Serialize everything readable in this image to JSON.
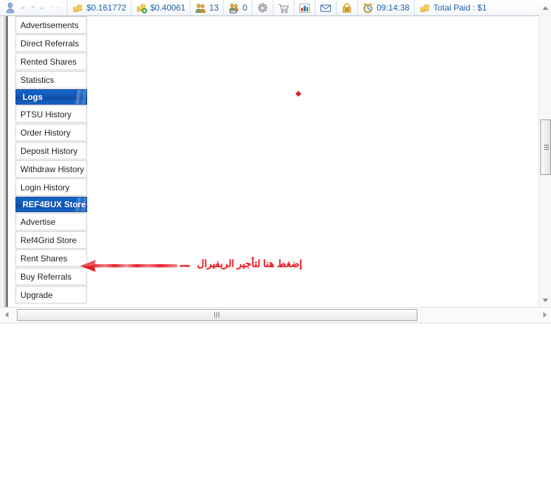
{
  "toolbar": {
    "items": [
      {
        "icon": "user-icon",
        "label": "",
        "redacted": true
      },
      {
        "icon": "coins-icon",
        "label": "$0.161772",
        "redacted": false
      },
      {
        "icon": "coins-add-icon",
        "label": "$0.40061",
        "redacted": false
      },
      {
        "icon": "referrals-icon",
        "label": "13",
        "redacted": false
      },
      {
        "icon": "rented-referrals-icon",
        "label": "0",
        "redacted": false
      },
      {
        "icon": "gear-icon",
        "label": "",
        "redacted": false
      },
      {
        "icon": "shopping-cart-icon",
        "label": "",
        "redacted": false
      },
      {
        "icon": "bar-chart-icon",
        "label": "",
        "redacted": false
      },
      {
        "icon": "envelope-icon",
        "label": "",
        "redacted": false
      },
      {
        "icon": "lock-icon",
        "label": "",
        "redacted": false
      },
      {
        "icon": "alarm-clock-icon",
        "label": "09:14:38",
        "redacted": false
      },
      {
        "icon": "coins-icon",
        "label": "Total Paid : $1",
        "redacted": false
      }
    ]
  },
  "sidebar": {
    "items": [
      {
        "label": "Advertisements",
        "type": "item"
      },
      {
        "label": "Direct Referrals",
        "type": "item"
      },
      {
        "label": "Rented Shares",
        "type": "item"
      },
      {
        "label": "Statistics",
        "type": "item"
      },
      {
        "label": "Logs",
        "type": "header"
      },
      {
        "label": "PTSU History",
        "type": "item"
      },
      {
        "label": "Order History",
        "type": "item"
      },
      {
        "label": "Deposit History",
        "type": "item"
      },
      {
        "label": "Withdraw History",
        "type": "item"
      },
      {
        "label": "Login History",
        "type": "item"
      },
      {
        "label": "REF4BUX Store",
        "type": "header"
      },
      {
        "label": "Advertise",
        "type": "item"
      },
      {
        "label": "Ref4Grid Store",
        "type": "item"
      },
      {
        "label": "Rent Shares",
        "type": "item"
      },
      {
        "label": "Buy Referrals",
        "type": "item"
      },
      {
        "label": "Upgrade",
        "type": "item"
      }
    ]
  },
  "annotation": {
    "text": "إضغط هنا لتأجير الريفيرال",
    "color": "#ee1c24"
  },
  "colors": {
    "accent_blue": "#1257b4",
    "link_blue": "#1c5fa8",
    "annotation_red": "#ee1c24"
  }
}
